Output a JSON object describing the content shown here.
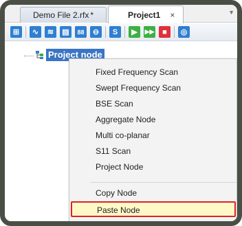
{
  "tabs": [
    {
      "label": "Demo File 2.rfx",
      "modified_mark": "*",
      "active": false
    },
    {
      "label": "Project1",
      "close": "×",
      "active": true
    }
  ],
  "toolbar": {
    "buttons": [
      {
        "icon": "project-tree-icon",
        "glyph": "⊞",
        "color": "#2f7fd1"
      },
      {
        "icon": "waveform-icon",
        "glyph": "∿",
        "color": "#2f7fd1"
      },
      {
        "icon": "swept-wave-icon",
        "glyph": "≋",
        "color": "#2f7fd1"
      },
      {
        "icon": "document-icon",
        "glyph": "▤",
        "color": "#2f7fd1"
      },
      {
        "icon": "aggregate-icon",
        "glyph": "88",
        "color": "#2f7fd1"
      },
      {
        "icon": "coplanar-icon",
        "glyph": "⊖",
        "color": "#2f7fd1"
      },
      {
        "icon": "s11-icon",
        "glyph": "S",
        "color": "#2f7fd1"
      },
      {
        "icon": "play-icon",
        "glyph": "▶",
        "color": "#3cb043"
      },
      {
        "icon": "fast-forward-icon",
        "glyph": "⏩",
        "color": "#3cb043"
      },
      {
        "icon": "stop-icon",
        "glyph": "■",
        "color": "#e0303a"
      },
      {
        "icon": "settings-icon",
        "glyph": "◎",
        "color": "#2f7fd1"
      }
    ]
  },
  "tree": {
    "root_label": "Project node"
  },
  "context_menu": {
    "items": [
      "Fixed Frequency Scan",
      "Swept Frequency Scan",
      "BSE Scan",
      "Aggregate Node",
      "Multi co-planar",
      "S11 Scan",
      "Project Node"
    ],
    "copy_label": "Copy Node",
    "paste_label": "Paste Node"
  },
  "colors": {
    "highlight_border": "#e02020",
    "selection": "#3a75c4"
  }
}
